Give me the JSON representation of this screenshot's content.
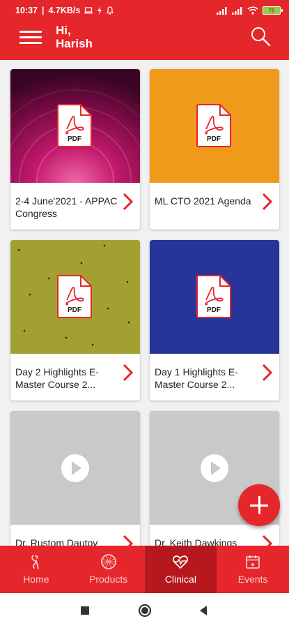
{
  "status_bar": {
    "time": "10:37",
    "network_speed": "4.7KB/s",
    "battery_level": "76"
  },
  "header": {
    "greeting_line1": "Hi,",
    "greeting_line2": "Harish",
    "menu_icon": "hamburger-menu-icon",
    "search_icon": "search-icon"
  },
  "cards": [
    {
      "title": "2-4 June'2021 - APPAC Congress",
      "type": "pdf",
      "thumb_color": "#a1125c"
    },
    {
      "title": "ML CTO 2021 Agenda",
      "type": "pdf",
      "thumb_color": "#f09a1c"
    },
    {
      "title": "Day 2 Highlights E-Master Course 2...",
      "type": "pdf",
      "thumb_color": "#a3a032"
    },
    {
      "title": "Day 1 Highlights E-Master Course 2...",
      "type": "pdf",
      "thumb_color": "#27359b"
    },
    {
      "title": "Dr. Rustom Dautov",
      "type": "video",
      "thumb_color": "#c9c9c9"
    },
    {
      "title": "Dr. Keith Dawkings",
      "type": "video",
      "thumb_color": "#c9c9c9"
    }
  ],
  "pdf_badge_text": "PDF",
  "fab": {
    "icon": "plus-icon"
  },
  "bottom_nav": [
    {
      "label": "Home",
      "icon": "home-icon",
      "active": false
    },
    {
      "label": "Products",
      "icon": "products-icon",
      "active": false
    },
    {
      "label": "Clinical",
      "icon": "clinical-heart-icon",
      "active": true
    },
    {
      "label": "Events",
      "icon": "calendar-icon",
      "active": false
    }
  ],
  "colors": {
    "brand_red": "#e5262b",
    "active_tab": "#b7181d"
  }
}
